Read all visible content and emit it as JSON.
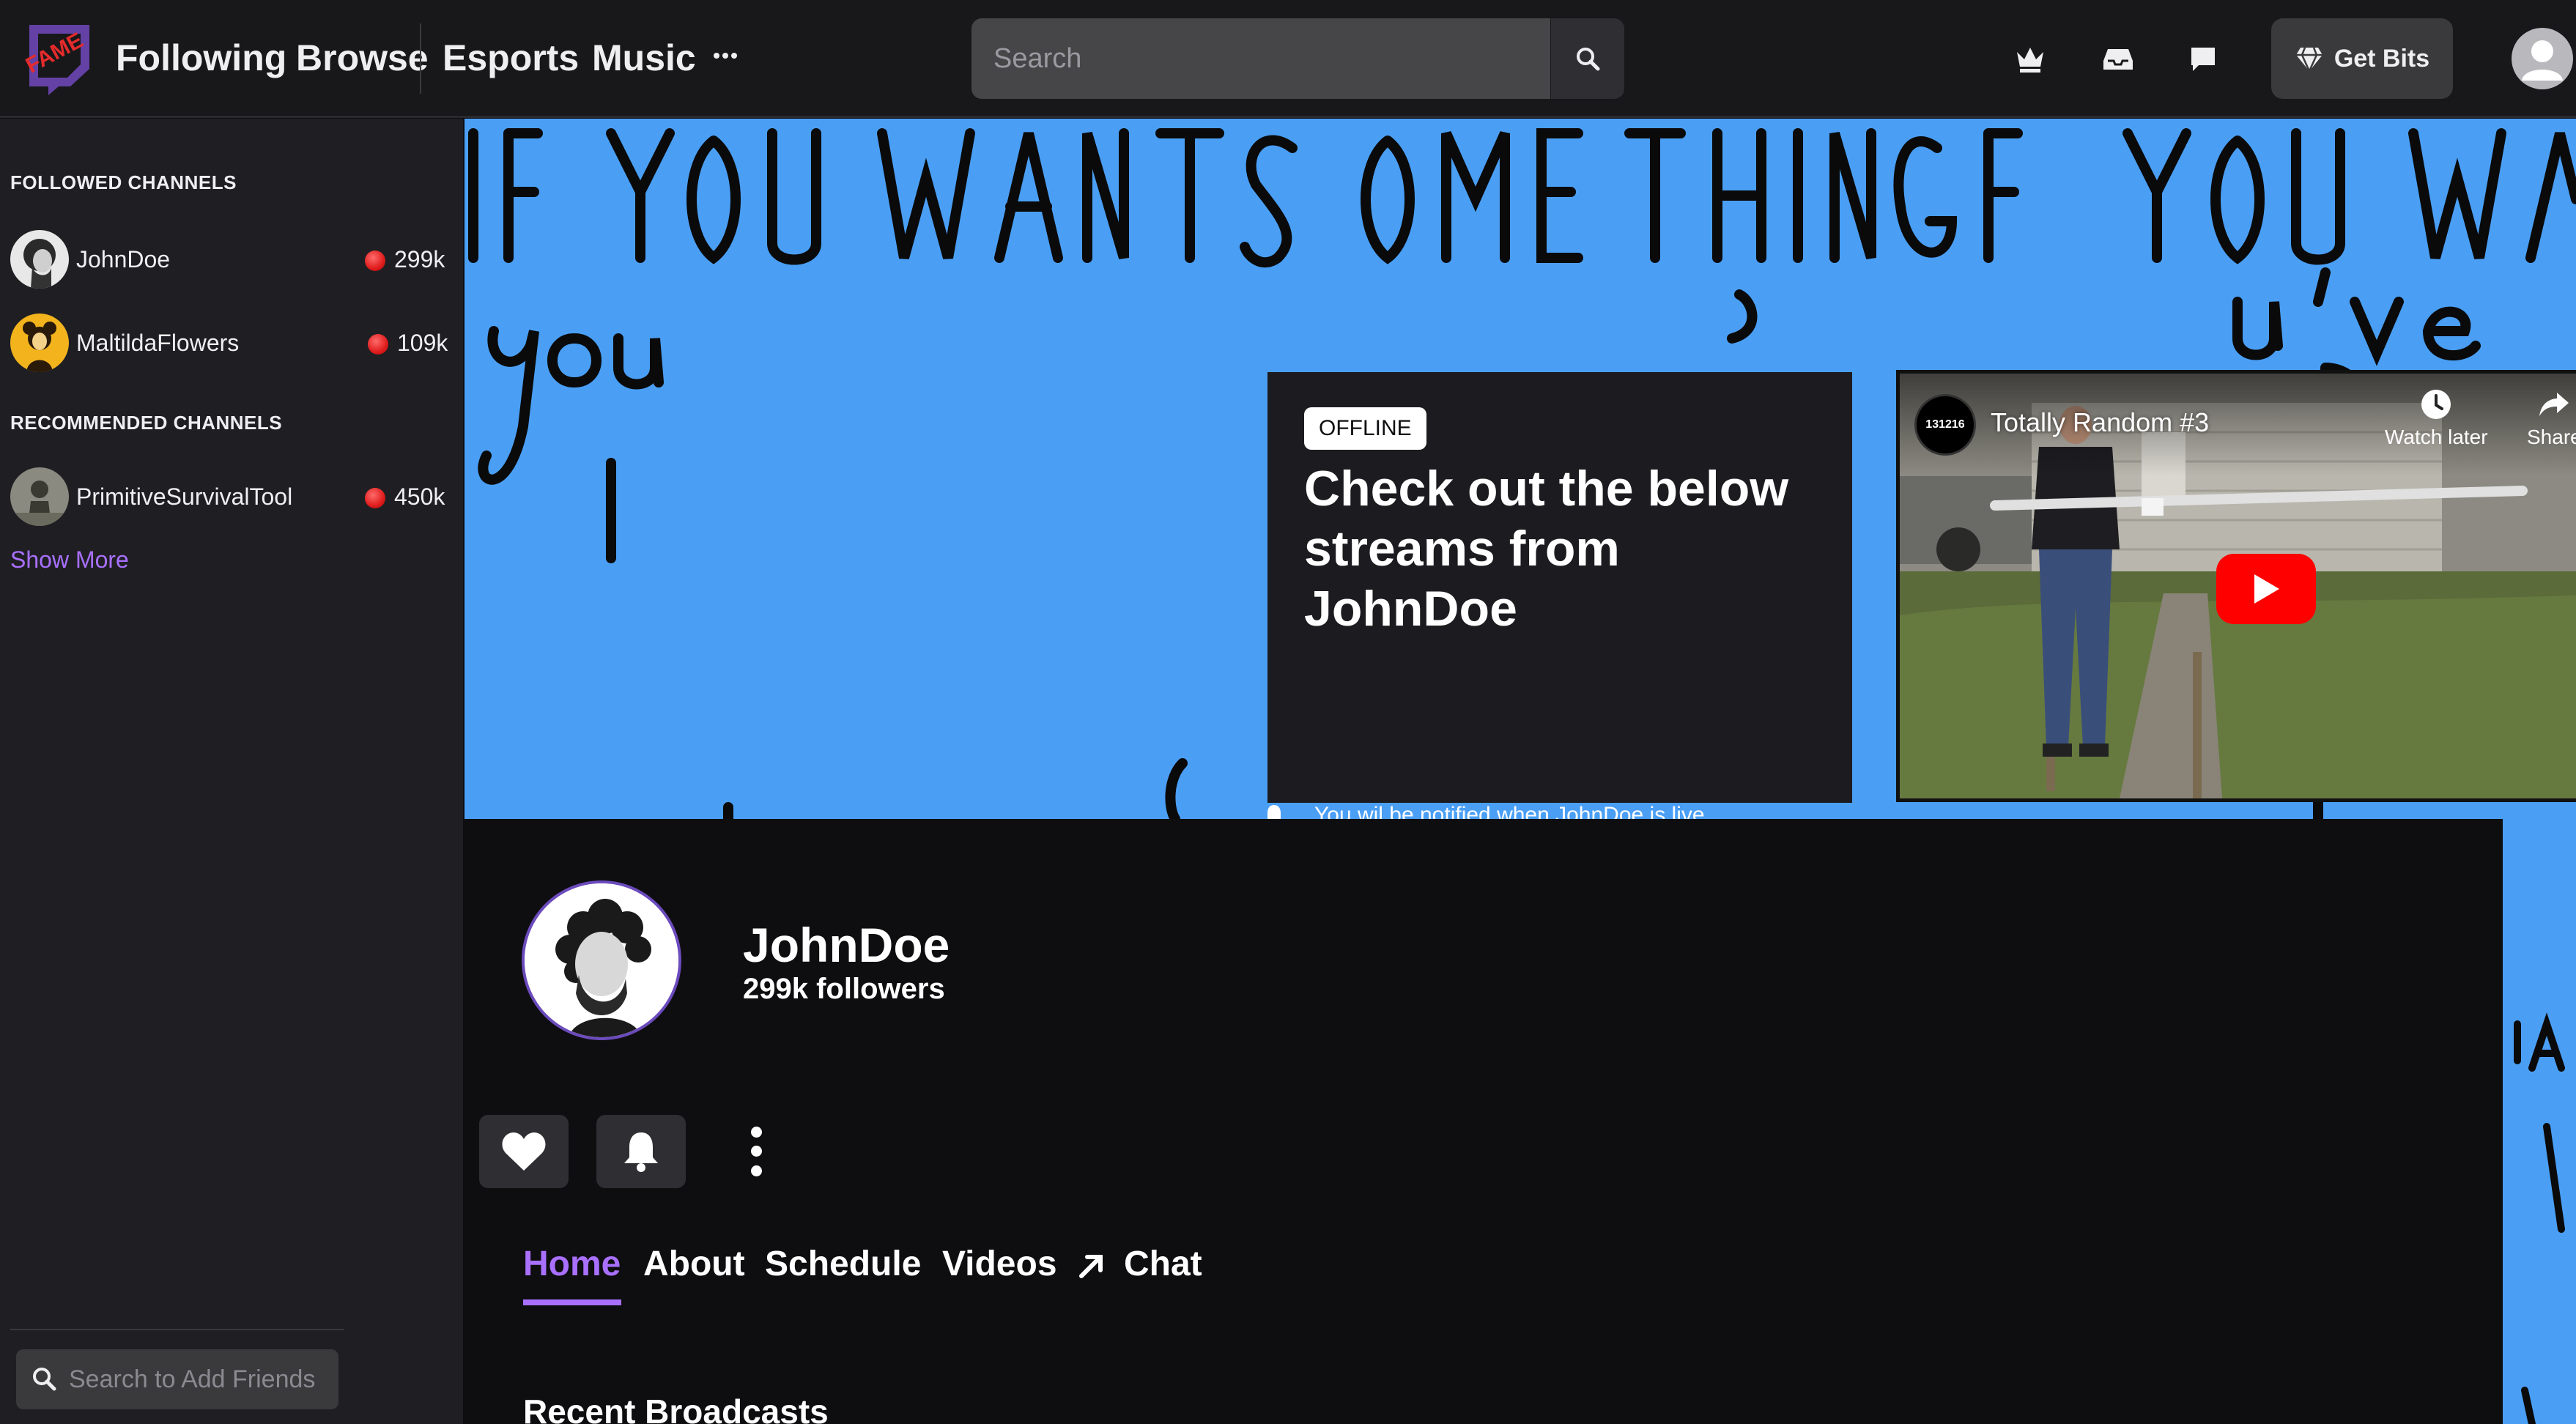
{
  "nav": {
    "links": [
      "Following",
      "Browse",
      "Esports",
      "Music"
    ],
    "search_placeholder": "Search",
    "get_bits_label": "Get Bits",
    "icons": [
      "crown-icon",
      "inbox-icon",
      "whisper-icon",
      "gem-icon",
      "user-avatar"
    ]
  },
  "sidebar": {
    "followed_heading": "FOLLOWED CHANNELS",
    "followed": [
      {
        "name": "JohnDoe",
        "viewers": "299k"
      },
      {
        "name": "MaltildaFlowers",
        "viewers": "109k"
      }
    ],
    "recommended_heading": "RECOMMENDED CHANNELS",
    "recommended": [
      {
        "name": "PrimitiveSurvivalTool",
        "viewers": "450k"
      }
    ],
    "show_more": "Show More",
    "friends_placeholder": "Search to Add Friends"
  },
  "banner": {
    "offline_badge": "OFFLINE",
    "offline_title": "Check out the below streams from JohnDoe",
    "notify_text": "You wil be notified when JohnDoe is live",
    "video": {
      "channel_badge": "131216",
      "title": "Totally Random #3",
      "watch_later": "Watch later",
      "share": "Share"
    }
  },
  "channel": {
    "name": "JohnDoe",
    "followers": "299k followers",
    "tabs": [
      "Home",
      "About",
      "Schedule",
      "Videos",
      "Chat"
    ],
    "active_tab": "Home",
    "section_title": "Recent Broadcasts"
  },
  "colors": {
    "accent": "#a970ff",
    "banner_bg": "#4a9ff5",
    "live_dot": "#e01c1c",
    "youtube_red": "#ff0000"
  }
}
